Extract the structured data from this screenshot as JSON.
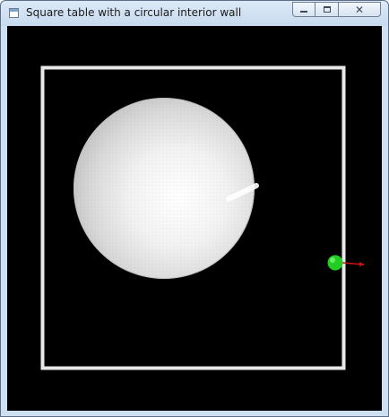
{
  "window": {
    "title": "Square table with a circular interior wall",
    "controls": {
      "minimize_icon": "minimize-icon",
      "maximize_icon": "maximize-icon",
      "close_icon": "close-icon",
      "close_glyph": "✕"
    }
  },
  "scene": {
    "background_color": "#000000",
    "table_wall_color": "#e8e8e8",
    "interior_wall_color": "#ffffff",
    "ball_color": "#22cc22",
    "velocity_vector_color": "#cc1111"
  }
}
